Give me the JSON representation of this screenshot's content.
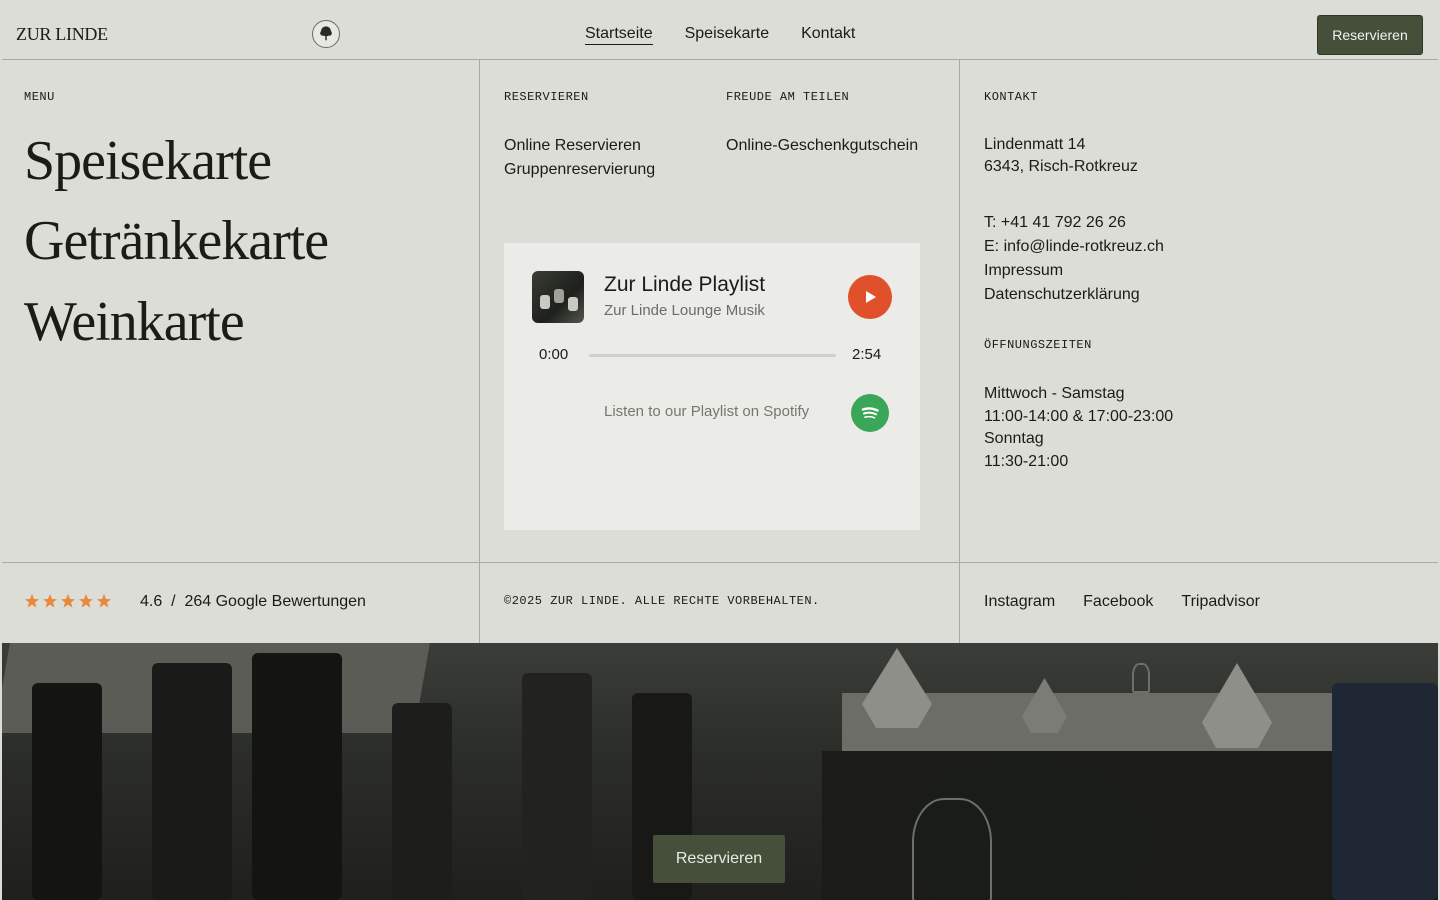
{
  "header": {
    "logo": "ZUR LINDE",
    "nav": [
      "Startseite",
      "Speisekarte",
      "Kontakt"
    ],
    "cta": "Reservieren"
  },
  "menu": {
    "label": "MENU",
    "items": [
      "Speisekarte",
      "Getränkekarte",
      "Weinkarte"
    ]
  },
  "reservieren": {
    "label": "RESERVIEREN",
    "links": [
      "Online Reservieren",
      "Gruppenreservierung"
    ]
  },
  "teilen": {
    "label": "FREUDE AM TEILEN",
    "links": [
      "Online-Geschenkgutschein"
    ]
  },
  "player": {
    "title": "Zur Linde Playlist",
    "subtitle": "Zur Linde Lounge Musik",
    "time_current": "0:00",
    "time_total": "2:54",
    "progress": 0,
    "spotify_text": "Listen to our Playlist on Spotify",
    "play_color": "#e0512b",
    "spotify_color": "#3aa657"
  },
  "kontakt": {
    "label": "KONTAKT",
    "address": [
      "Lindenmatt 14",
      "6343, Risch-Rotkreuz"
    ],
    "lines": [
      "T: +41 41 792 26 26",
      "E: info@linde-rotkreuz.ch",
      "Impressum",
      "Datenschutzerklärung"
    ]
  },
  "oeffnungszeiten": {
    "label": "ÖFFNUNGSZEITEN",
    "lines": [
      "Mittwoch - Samstag",
      "11:00-14:00 & 17:00-23:00",
      "Sonntag",
      "11:30-21:00"
    ]
  },
  "footer": {
    "stars": 5,
    "star_color": "#e8893a",
    "rating": "4.6  /  264 Google Bewertungen",
    "copyright": "©2025 ZUR LINDE. ALLE RECHTE VORBEHALTEN.",
    "social": [
      "Instagram",
      "Facebook",
      "Tripadvisor"
    ]
  },
  "hero": {
    "cta": "Reservieren"
  },
  "colors": {
    "background": "#dcddd7",
    "button": "#454f3a"
  }
}
